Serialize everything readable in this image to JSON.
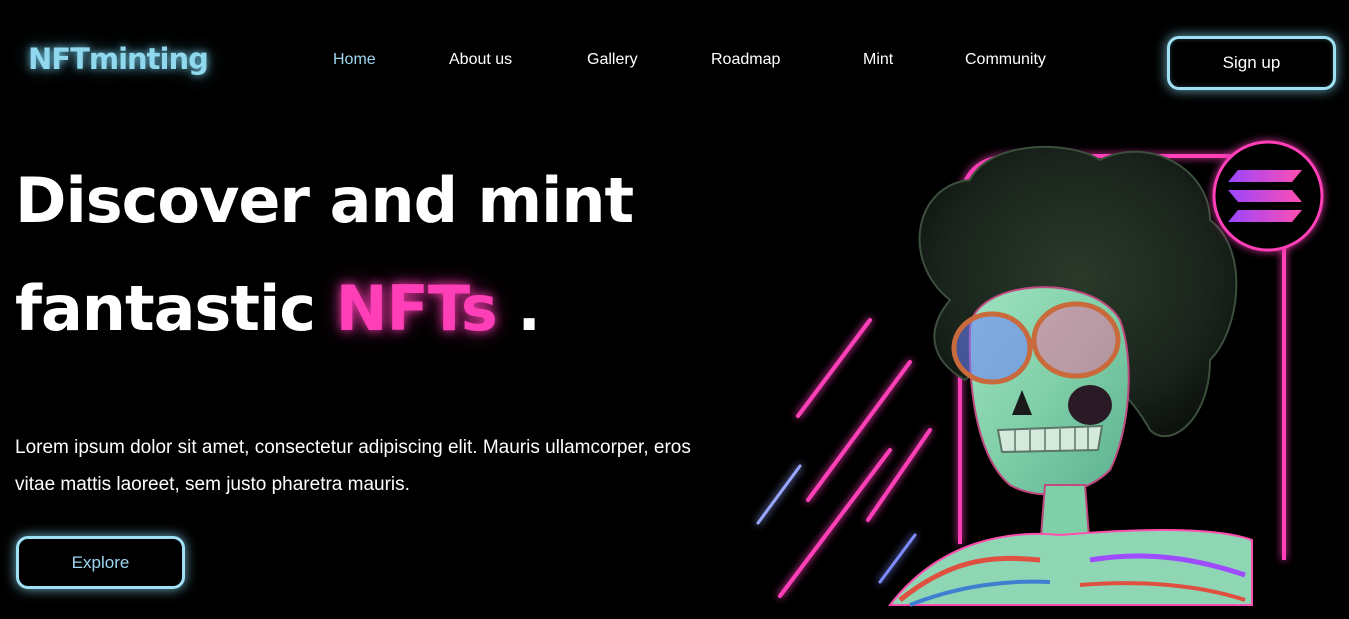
{
  "header": {
    "logo": "NFTminting",
    "nav": [
      {
        "label": "Home",
        "active": true
      },
      {
        "label": "About us",
        "active": false
      },
      {
        "label": "Gallery",
        "active": false
      },
      {
        "label": "Roadmap",
        "active": false
      },
      {
        "label": "Mint",
        "active": false
      },
      {
        "label": "Community",
        "active": false
      }
    ],
    "signup_label": "Sign up"
  },
  "hero": {
    "title_line1": "Discover and mint",
    "title_line2_prefix": "fantastic",
    "title_highlight": "NFTs",
    "title_suffix": ".",
    "description": "Lorem ipsum dolor sit amet, consectetur adipiscing elit. Mauris ullamcorper, eros vitae mattis laoreet, sem justo pharetra mauris.",
    "explore_label": "Explore"
  },
  "illustration": {
    "subject": "skeleton-nft-artwork",
    "badge_icon": "solana-logo-icon"
  },
  "colors": {
    "background": "#000000",
    "accent_cyan": "#9fe0f4",
    "accent_pink": "#ff3fb8"
  }
}
